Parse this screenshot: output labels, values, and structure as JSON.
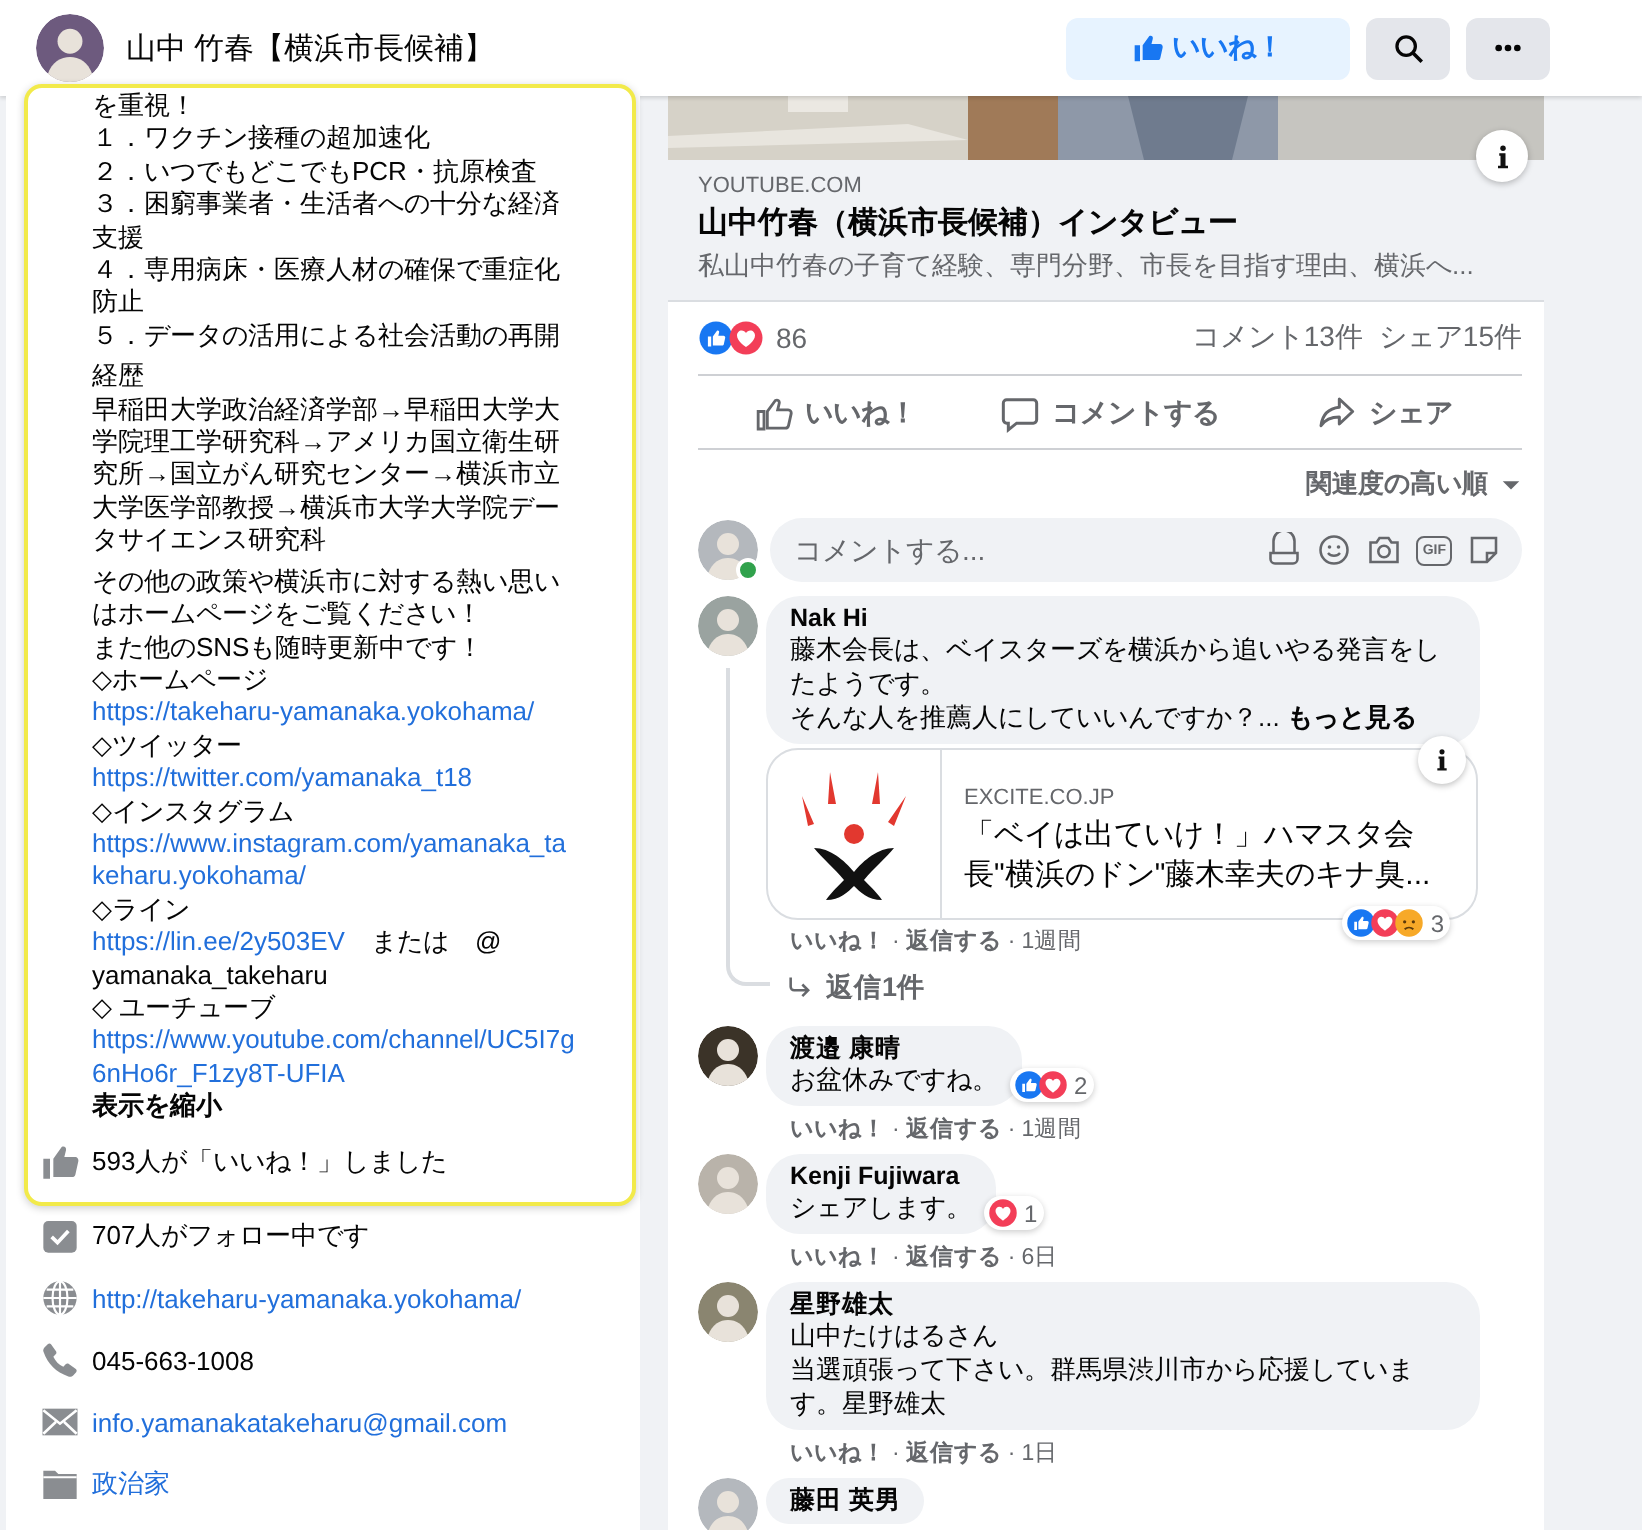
{
  "header": {
    "page_name": "山中 竹春【横浜市長候補】",
    "like_button": "いいね！"
  },
  "about": {
    "paragraphs": [
      [
        [
          {
            "kind": "text",
            "text": "を重視！"
          }
        ],
        [
          {
            "kind": "text",
            "text": "１．ワクチン接種の超加速化"
          }
        ],
        [
          {
            "kind": "text",
            "text": "２．いつでもどこでもPCR・抗原検査"
          }
        ],
        [
          {
            "kind": "text",
            "text": "３．困窮事業者・生活者への十分な経済支援"
          }
        ],
        [
          {
            "kind": "text",
            "text": "４．専用病床・医療人材の確保で重症化防止"
          }
        ],
        [
          {
            "kind": "text",
            "text": "５．データの活用による社会活動の再開"
          }
        ]
      ],
      [
        [
          {
            "kind": "text",
            "text": "経歴"
          }
        ],
        [
          {
            "kind": "text",
            "text": "早稲田大学政治経済学部→早稲田大学大学院理工学研究科→アメリカ国立衛生研究所→国立がん研究センター→横浜市立大学医学部教授→横浜市大学大学院データサイエンス研究科"
          }
        ]
      ],
      [
        [
          {
            "kind": "text",
            "text": "その他の政策や横浜市に対する熱い思いはホームページをご覧ください！"
          }
        ],
        [
          {
            "kind": "text",
            "text": "また他のSNSも随時更新中です！"
          }
        ],
        [
          {
            "kind": "text",
            "text": "◇ホームページ"
          }
        ],
        [
          {
            "kind": "link",
            "text": "https://takeharu-yamanaka.yokohama/"
          }
        ],
        [
          {
            "kind": "text",
            "text": "◇ツイッター"
          }
        ],
        [
          {
            "kind": "link",
            "text": "https://twitter.com/yamanaka_t18"
          }
        ],
        [
          {
            "kind": "text",
            "text": "◇インスタグラム"
          }
        ],
        [
          {
            "kind": "link",
            "text": "https://www.instagram.com/yamanaka_takeharu.yokohama/"
          }
        ],
        [
          {
            "kind": "text",
            "text": "◇ライン"
          }
        ],
        [
          {
            "kind": "link",
            "text": "https://lin.ee/2y503EV"
          },
          {
            "kind": "text",
            "text": "　または　@"
          }
        ],
        [
          {
            "kind": "text",
            "text": "yamanaka_takeharu"
          }
        ],
        [
          {
            "kind": "text",
            "text": "◇ ユーチューブ"
          }
        ],
        [
          {
            "kind": "link",
            "text": "https://www.youtube.com/channel/UC5I7g6nHo6r_F1zy8T-UFIA"
          },
          {
            "kind": "toggle",
            "text": "表示を縮小"
          }
        ]
      ]
    ]
  },
  "info": [
    {
      "kind": "likes",
      "text": "593人が「いいね！」しました",
      "link": false
    },
    {
      "kind": "followers",
      "text": "707人がフォロー中です",
      "link": false
    },
    {
      "kind": "website",
      "text": "http://takeharu-yamanaka.yokohama/",
      "link": true
    },
    {
      "kind": "phone",
      "text": "045-663-1008",
      "link": false
    },
    {
      "kind": "email",
      "text": "info.yamanakatakeharu@gmail.com",
      "link": true
    },
    {
      "kind": "category",
      "text": "政治家",
      "link": true
    }
  ],
  "post": {
    "preview": {
      "source": "YOUTUBE.COM",
      "title": "山中竹春（横浜市長候補）インタビュー",
      "description": "私山中竹春の子育て経験、専門分野、市長を目指す理由、横浜へ..."
    },
    "reactions": [
      {
        "kind": "like"
      },
      {
        "kind": "love"
      }
    ],
    "reaction_count": "86",
    "comments_count": "コメント13件",
    "shares_count": "シェア15件",
    "actions": [
      {
        "kind": "like",
        "label": "いいね！"
      },
      {
        "kind": "comment",
        "label": "コメントする"
      },
      {
        "kind": "share",
        "label": "シェア"
      }
    ],
    "sort": "関連度の高い順",
    "composer": {
      "placeholder": "コメントする...",
      "online": true,
      "gif": "GIF"
    },
    "meta_separator": "·",
    "comments": [
      {
        "author": "Nak Hi",
        "lines": [
          "藤木会長は、ベイスターズを横浜から追いやる発言をしたようです。",
          "そんな人を推薦人にしていいんですか？..."
        ],
        "more": "もっと見る",
        "link_preview": {
          "source": "EXCITE.CO.JP",
          "title": "「ベイは出ていけ！」ハマスタ会長\"横浜のドン\"藤木幸夫のキナ臭..."
        },
        "reactions": [
          {
            "kind": "like"
          },
          {
            "kind": "love"
          },
          {
            "kind": "sad"
          }
        ],
        "reaction_count": "3",
        "meta": [
          "いいね！",
          "返信する",
          "1週間"
        ],
        "replies": "返信1件"
      },
      {
        "author": "渡邉 康晴",
        "lines": [
          "お盆休みですね。"
        ],
        "reactions": [
          {
            "kind": "like"
          },
          {
            "kind": "love"
          }
        ],
        "reaction_count": "2",
        "meta": [
          "いいね！",
          "返信する",
          "1週間"
        ]
      },
      {
        "author": "Kenji Fujiwara",
        "lines": [
          "シェアします。"
        ],
        "reactions": [
          {
            "kind": "love"
          }
        ],
        "reaction_count": "1",
        "meta": [
          "いいね！",
          "返信する",
          "6日"
        ]
      },
      {
        "author": "星野雄太",
        "lines": [
          "山中たけはるさん",
          "当選頑張って下さい。群馬県渋川市から応援しています。星野雄太"
        ],
        "meta": [
          "いいね！",
          "返信する",
          "1日"
        ]
      },
      {
        "author": "藤田 英男"
      }
    ]
  }
}
